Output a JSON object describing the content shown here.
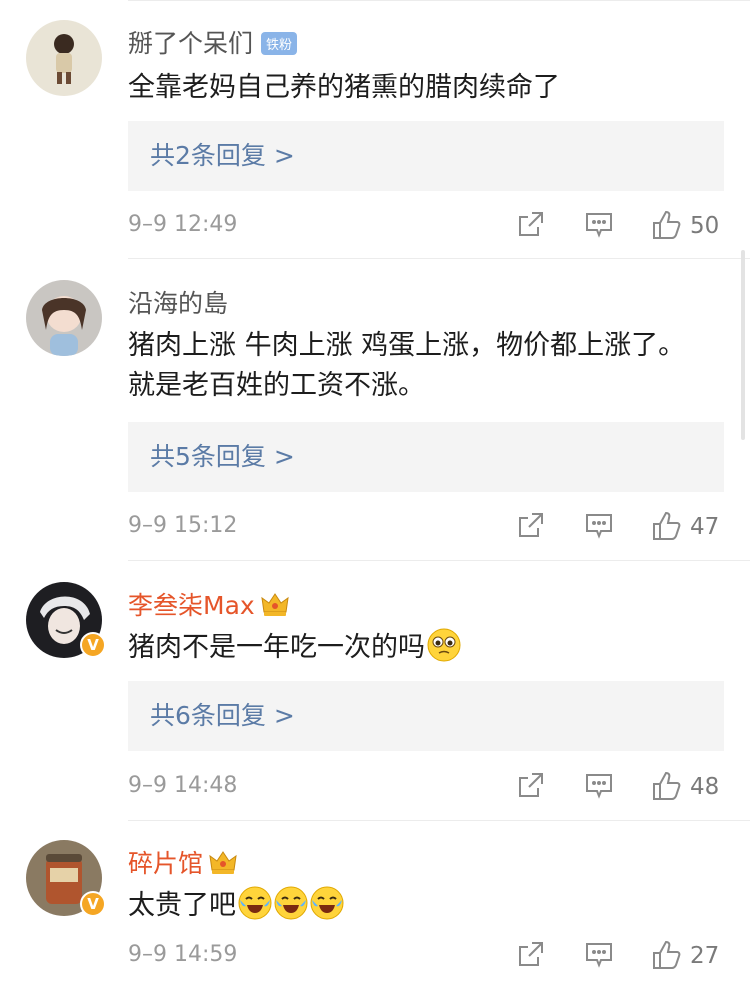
{
  "comments": [
    {
      "username": "掰了个呆们",
      "badge": "铁粉",
      "text": "全靠老妈自己养的猪熏的腊肉续命了",
      "replies": "共2条回复 >",
      "time": "9–9 12:49",
      "likes": "50"
    },
    {
      "username": "沿海的島",
      "text": "猪肉上涨 牛肉上涨 鸡蛋上涨，物价都上涨了。就是老百姓的工资不涨。",
      "replies": "共5条回复 >",
      "time": "9–9 15:12",
      "likes": "47"
    },
    {
      "username": "李叁柒Max",
      "text": "猪肉不是一年吃一次的吗",
      "replies": "共6条回复 >",
      "time": "9–9 14:48",
      "likes": "48"
    },
    {
      "username": "碎片馆",
      "text": "太贵了吧",
      "time": "9–9 14:59",
      "likes": "27"
    }
  ],
  "icons": {
    "repost": "share-icon",
    "comment": "comment-icon",
    "like": "thumbs-up-icon",
    "vip": "crown-icon",
    "verified": "verified-v-icon"
  },
  "colors": {
    "vip_name": "#e5552a",
    "reply_link": "#5b7ba6",
    "verified_badge": "#f5a623"
  }
}
